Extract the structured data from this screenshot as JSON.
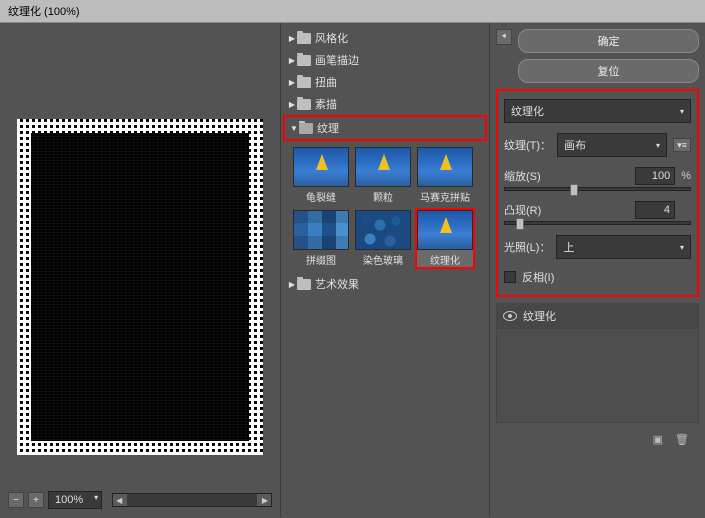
{
  "window": {
    "title": "纹理化 (100%)"
  },
  "zoom": {
    "value": "100%"
  },
  "categories": [
    {
      "label": "风格化",
      "open": false
    },
    {
      "label": "画笔描边",
      "open": false
    },
    {
      "label": "扭曲",
      "open": false
    },
    {
      "label": "素描",
      "open": false
    },
    {
      "label": "纹理",
      "open": true
    },
    {
      "label": "艺术效果",
      "open": false
    }
  ],
  "thumbs": {
    "r1": [
      {
        "label": "龟裂缝"
      },
      {
        "label": "颗粒"
      },
      {
        "label": "马赛克拼贴"
      }
    ],
    "r2": [
      {
        "label": "拼缀图"
      },
      {
        "label": "染色玻璃"
      },
      {
        "label": "纹理化"
      }
    ]
  },
  "buttons": {
    "ok": "确定",
    "reset": "复位"
  },
  "settings": {
    "filter_name": "纹理化",
    "texture_label": "纹理(T)：",
    "texture_value": "画布",
    "scale_label": "缩放(S)",
    "scale_value": "100",
    "scale_pct": "%",
    "relief_label": "凸现(R)",
    "relief_value": "4",
    "light_label": "光照(L)：",
    "light_value": "上",
    "invert_label": "反相(I)"
  },
  "layers": {
    "current": "纹理化"
  },
  "chart_data": null
}
